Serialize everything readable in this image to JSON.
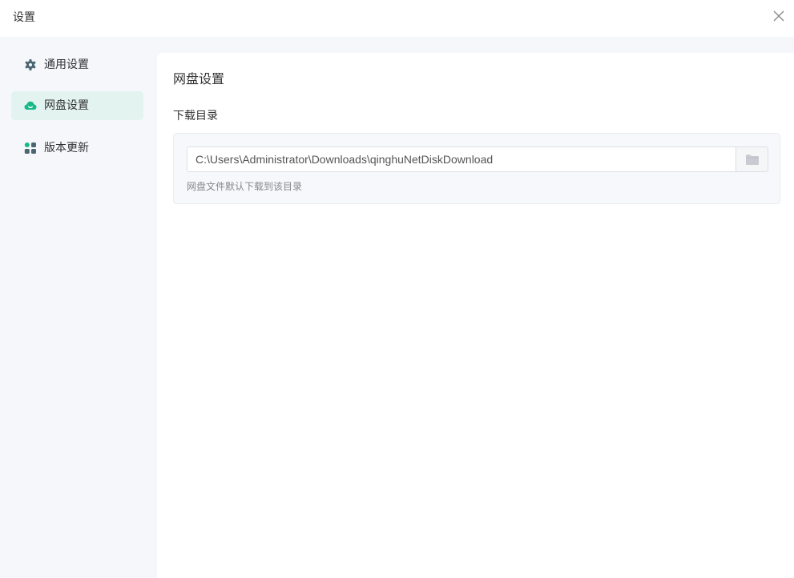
{
  "window": {
    "title": "设置"
  },
  "sidebar": {
    "items": [
      {
        "label": "通用设置",
        "icon": "gear-icon",
        "active": false
      },
      {
        "label": "网盘设置",
        "icon": "cloud-icon",
        "active": true
      },
      {
        "label": "版本更新",
        "icon": "grid-icon",
        "active": false
      }
    ]
  },
  "main": {
    "section_title": "网盘设置",
    "download_dir": {
      "label": "下载目录",
      "value": "C:\\Users\\Administrator\\Downloads\\qinghuNetDiskDownload",
      "hint": "网盘文件默认下载到该目录",
      "browse_icon": "folder-icon"
    }
  },
  "colors": {
    "accent": "#17b987",
    "icon_gray": "#4a6670",
    "active_bg": "#e3f3f0",
    "sidebar_bg": "#f5f7fb"
  }
}
